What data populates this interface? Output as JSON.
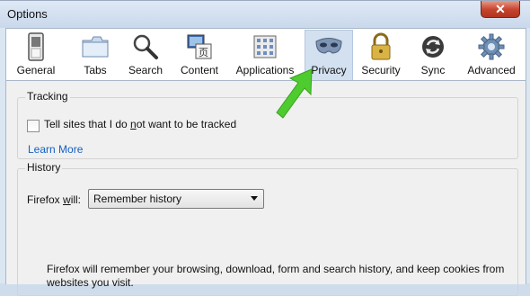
{
  "window": {
    "title": "Options",
    "close_label": "✕"
  },
  "toolbar": {
    "items": [
      {
        "label": "General",
        "icon": "general-switch-icon"
      },
      {
        "label": "Tabs",
        "icon": "tabs-folder-icon"
      },
      {
        "label": "Search",
        "icon": "magnifier-icon"
      },
      {
        "label": "Content",
        "icon": "content-pictures-icon"
      },
      {
        "label": "Applications",
        "icon": "applications-grid-icon"
      },
      {
        "label": "Privacy",
        "icon": "privacy-mask-icon",
        "selected": true
      },
      {
        "label": "Security",
        "icon": "padlock-icon"
      },
      {
        "label": "Sync",
        "icon": "sync-arrows-icon"
      },
      {
        "label": "Advanced",
        "icon": "gear-icon"
      }
    ]
  },
  "tracking": {
    "title": "Tracking",
    "do_not_track": {
      "checked": false,
      "label_pre": "Tell sites that I do ",
      "label_key": "n",
      "label_post": "ot want to be tracked"
    },
    "learn_more": "Learn More"
  },
  "history": {
    "title": "History",
    "firefox_will_pre": "Firefox ",
    "firefox_will_key": "w",
    "firefox_will_post": "ill:",
    "select_value": "Remember history",
    "description": "Firefox will remember your browsing, download, form and search history, and keep cookies from websites you visit."
  },
  "colors": {
    "accent": "#1560c3",
    "selected_tab": "#d2e0ef",
    "annotation_arrow": "#4ecb2f"
  }
}
